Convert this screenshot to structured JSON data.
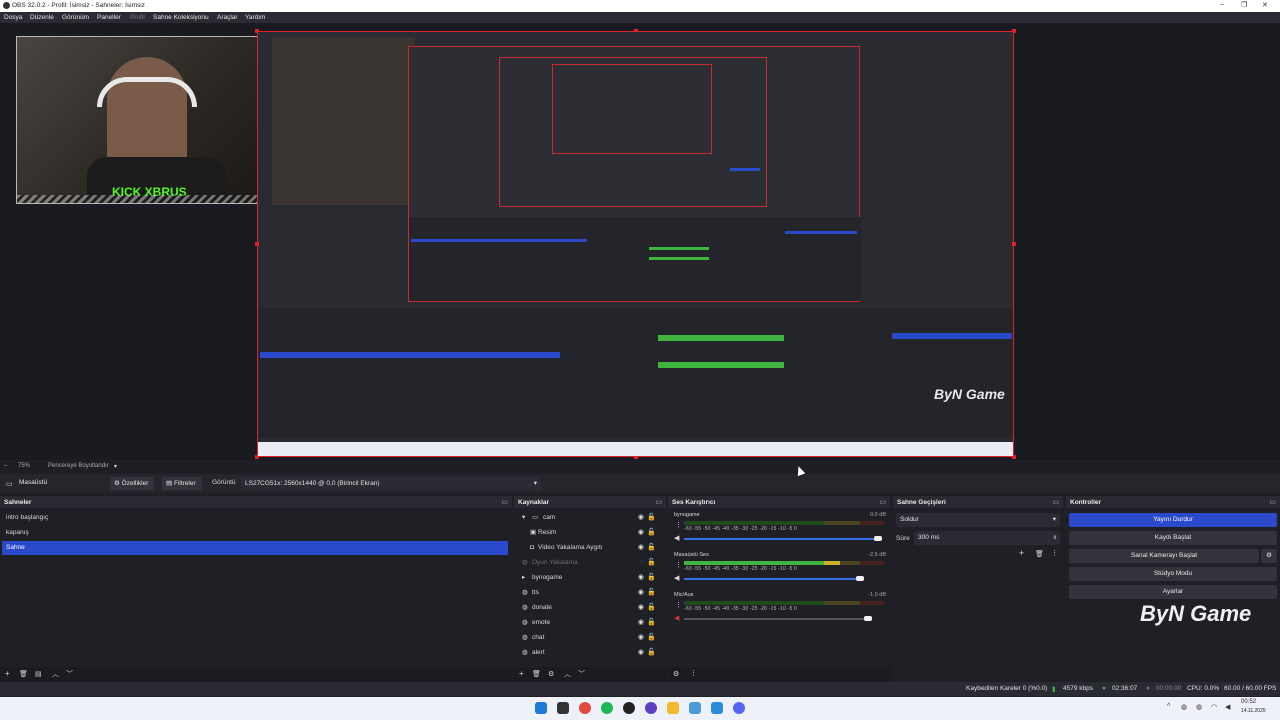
{
  "window": {
    "title": "OBS 32.0.2 - Profil: İsimsiz - Sahneler: İsimsiz",
    "min": "–",
    "max": "❐",
    "close": "✕"
  },
  "menu": [
    "Dosya",
    "Düzenle",
    "Görünüm",
    "Paneller",
    "Profil",
    "Sahne Koleksiyonu",
    "Araçlar",
    "Yardım"
  ],
  "preview": {
    "zoom": "75%",
    "mode": "Pencereye Boyutlandır"
  },
  "webcam": {
    "overlay_text": "KICK XBRUS"
  },
  "canvas_logo": "ByN Game",
  "context": {
    "source_name": "Masaüstü",
    "properties_label": "Özellikler",
    "filters_label": "Filtreler",
    "display_label": "Görüntü",
    "display_value": "LS27CG51x: 2560x1440 @ 0,0 (Birincil Ekran)"
  },
  "scenes": {
    "title": "Sahneler",
    "items": [
      {
        "label": "intro başlangıç"
      },
      {
        "label": "kapanış"
      },
      {
        "label": "Sahne",
        "selected": true
      }
    ]
  },
  "sources": {
    "title": "Kaynaklar",
    "items": [
      {
        "label": "cam",
        "type": "group",
        "indent": 0
      },
      {
        "label": "Resim",
        "type": "image",
        "indent": 1
      },
      {
        "label": "Video Yakalama Aygıtı",
        "type": "camera",
        "indent": 1
      },
      {
        "label": "Oyun Yakalama",
        "type": "game",
        "indent": 0,
        "hidden": true
      },
      {
        "label": "bynogame",
        "type": "folder",
        "indent": 0
      },
      {
        "label": "tts",
        "type": "browser",
        "indent": 0
      },
      {
        "label": "donate",
        "type": "browser",
        "indent": 0
      },
      {
        "label": "emote",
        "type": "browser",
        "indent": 0
      },
      {
        "label": "chat",
        "type": "browser",
        "indent": 0
      },
      {
        "label": "alert",
        "type": "browser",
        "indent": 0
      }
    ]
  },
  "mixer": {
    "title": "Ses Karıştırıcı",
    "ticks": "-60 -55 -50 -45 -40 -35 -30 -25 -20 -15 -10 -5 0",
    "channels": [
      {
        "name": "bynogame",
        "db": "0.0 dB",
        "level": 0.0,
        "volume": 0.97
      },
      {
        "name": "Masaüstü Ses",
        "db": "-2.5 dB",
        "level": 0.78,
        "volume": 0.88
      },
      {
        "name": "Mic/Aux",
        "db": "-1.0 dB",
        "level": 0.0,
        "volume": 0.92
      }
    ]
  },
  "transitions": {
    "title": "Sahne Geçişleri",
    "selected": "Soldur",
    "duration_label": "Süre",
    "duration_value": "300 ms"
  },
  "controls": {
    "title": "Kontroller",
    "buttons": [
      "Yayını Durdur",
      "Kaydı Başlat",
      "Sanal Kamerayı Başlat",
      "Stüdyo Modu",
      "Ayarlar"
    ],
    "logo": "ByN Game"
  },
  "status": {
    "dropped": "Kaybedilen Kareler 0 (%0.0)",
    "bitrate": "4579 kbps",
    "stream_time": "02:36:07",
    "rec_time": "00:00:00",
    "cpu": "CPU: 0.0%",
    "fps": "60.00 / 60.00 FPS"
  },
  "taskbar": {
    "time": "00:52",
    "date": "14.11.2025"
  },
  "colors": {
    "accent": "#2a4acb",
    "selection_red": "#e0202a",
    "meter_green": "#3fb43f",
    "meter_yellow": "#c8b32b",
    "meter_red": "#b02a2a"
  }
}
